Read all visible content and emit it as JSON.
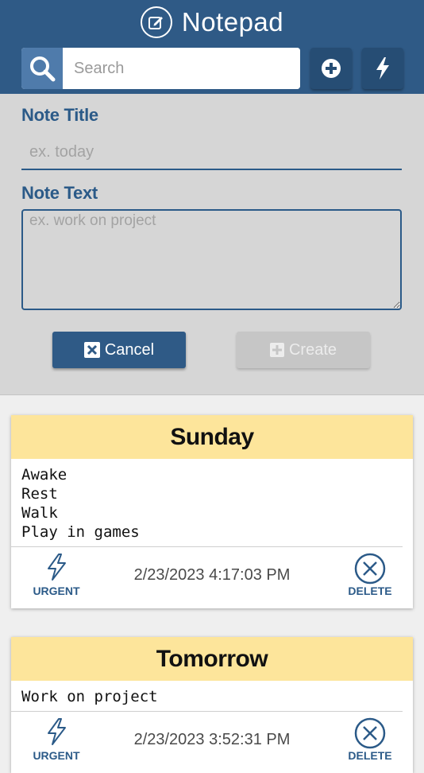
{
  "header": {
    "app_title": "Notepad",
    "app_icon": "edit-note-icon",
    "search_placeholder": "Search",
    "search_icon": "search-icon",
    "add_icon": "plus-circle-icon",
    "urgent_icon": "lightning-icon"
  },
  "form": {
    "title_label": "Note Title",
    "title_placeholder": "ex. today",
    "text_label": "Note Text",
    "text_placeholder": "ex. work on project",
    "cancel_label": "Cancel",
    "create_label": "Create"
  },
  "notes": [
    {
      "title": "Sunday",
      "body": "Awake\nRest\nWalk\nPlay in games",
      "date": "2/23/2023 4:17:03 PM",
      "urgent_label": "URGENT",
      "delete_label": "DELETE"
    },
    {
      "title": "Tomorrow",
      "body": "Work on project",
      "date": "2/23/2023 3:52:31 PM",
      "urgent_label": "URGENT",
      "delete_label": "DELETE"
    }
  ],
  "colors": {
    "primary": "#2f5a86",
    "accent": "#2b5a88",
    "card_header": "#fde59b",
    "form_bg": "#d6d6d6"
  }
}
